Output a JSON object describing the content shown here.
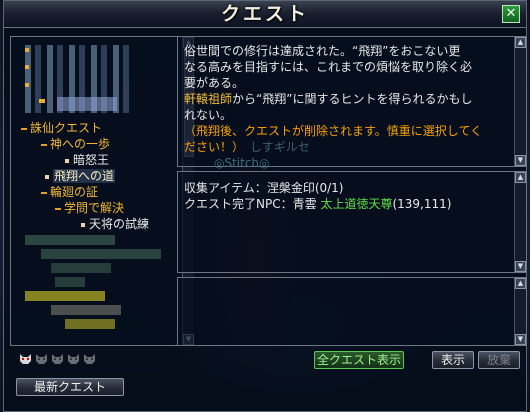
{
  "window": {
    "title": "クエスト",
    "close_label": "✕"
  },
  "tree": {
    "items": [
      {
        "label": "誅仙クエスト",
        "level": 0,
        "style": "gold"
      },
      {
        "label": "神への一歩",
        "level": 1,
        "style": "gold"
      },
      {
        "label": "暗怒王",
        "level": 2,
        "style": "white"
      },
      {
        "label": "飛翔への道",
        "level": 1,
        "style": "selected"
      },
      {
        "label": "輪廻の証",
        "level": 1,
        "style": "gold"
      },
      {
        "label": "学問で解決",
        "level": 2,
        "style": "gold"
      },
      {
        "label": "天将の試練",
        "level": 3,
        "style": "white"
      }
    ]
  },
  "description": {
    "line1": "俗世間での修行は達成された。“飛翔”をおこない更",
    "line2": "なる高みを目指すには、これまでの煩悩を取り除く必",
    "line3": "要がある。",
    "line4_name": "軒轅祖師",
    "line4_rest": "から“飛翔”に関するヒントを得られるかもし",
    "line5": "れない。",
    "line6": "（飛翔後、クエストが削除されます。慎重に選択してく",
    "line7": "ださい！）",
    "ghost": "しすギルセ",
    "ghost2": "◎Stitch◎"
  },
  "info": {
    "collect_label": "収集アイテム：",
    "collect_item": "涅槃金印(0/1)",
    "npc_label": "クエスト完了NPC：",
    "npc_place": "青雲",
    "npc_name": "太上道徳天尊",
    "npc_coords": "(139,111)"
  },
  "buttons": {
    "show_all": "全クエスト表示",
    "display": "表示",
    "abandon": "放棄",
    "latest": "最新クエスト"
  },
  "colors": {
    "gold": "#f0b838",
    "orange": "#f5a000",
    "green": "#60e048"
  }
}
